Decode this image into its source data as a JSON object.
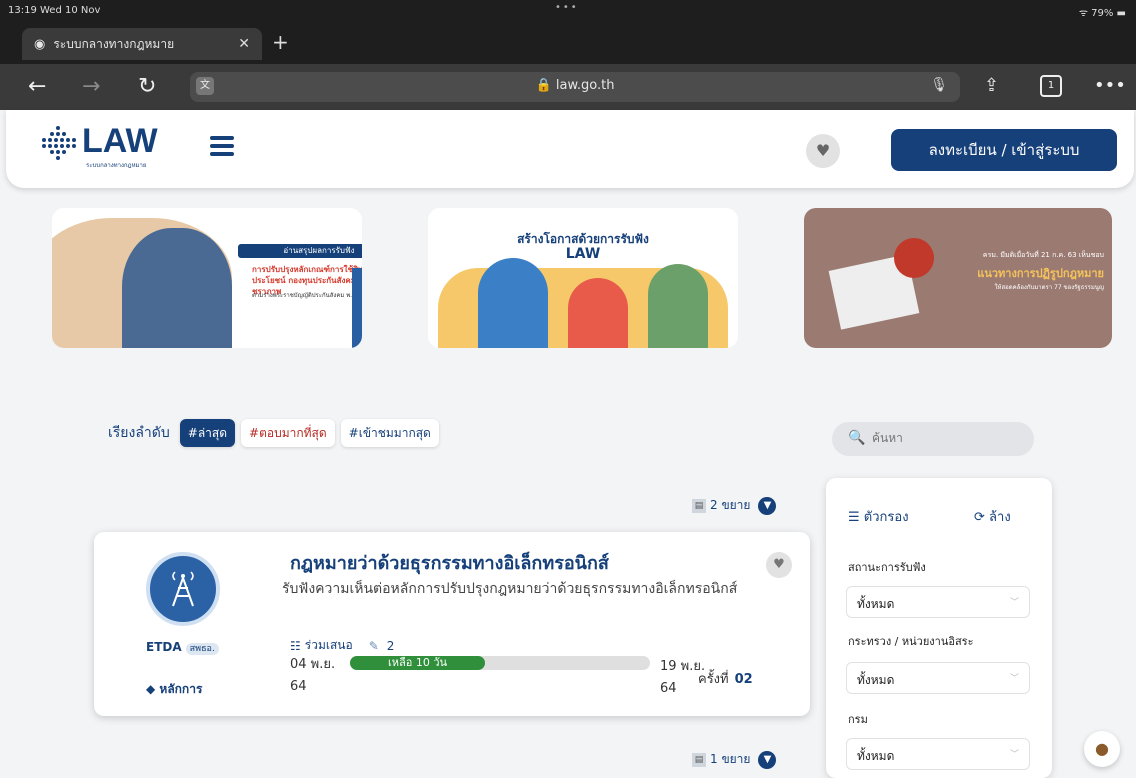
{
  "status_bar": {
    "time": "13:19  Wed 10 Nov",
    "dots": "•••",
    "battery": "79%"
  },
  "browser": {
    "tab_title": "ระบบกลางทางกฎหมาย",
    "tab_close": "✕",
    "new_tab": "+",
    "url": "law.go.th",
    "tab_count": "1"
  },
  "site": {
    "logo_text": "LAW",
    "logo_tagline": "ระบบกลางทางกฎหมาย",
    "register_label": "ลงทะเบียน / เข้าสู่ระบบ"
  },
  "banners": [
    {
      "label": "อ่านสรุปผลการรับฟัง",
      "headline": "การปรับปรุงหลักเกณฑ์การใช้สิทธิประโยชน์ กองทุนประกันสังคมกรณีชราภาพ",
      "subtext": "ตามร่างพระราชบัญญัติประกันสังคม พ.ศ. ...."
    },
    {
      "headline": "สร้างโอกาสด้วยการรับฟัง",
      "brand": "LAW"
    },
    {
      "line1": "ครม. มีมติเมื่อวันที่ 21 ก.ค. 63 เห็นชอบ",
      "headline": "แนวทางการปฏิรูปกฎหมาย",
      "line3": "ให้สอดคล้องกับมาตรา 77 ของรัฐธรรมนูญ"
    }
  ],
  "sort": {
    "label": "เรียงลำดับ",
    "options": [
      "#ล่าสุด",
      "#ตอบมากที่สุด",
      "#เข้าชมมากสุด"
    ]
  },
  "search": {
    "placeholder": "ค้นหา"
  },
  "expand_top": {
    "label": "2 ขยาย"
  },
  "expand_bottom": {
    "label": "1 ขยาย"
  },
  "card": {
    "agency": "ETDA",
    "agency_sub": "สพธอ.",
    "category": "หลักการ",
    "title": "กฎหมายว่าด้วยธุรกรรมทางอิเล็กทรอนิกส์",
    "description": "รับฟังความเห็นต่อหลักการปรับปรุงกฎหมายว่าด้วยธุรกรรมทางอิเล็กทรอนิกส์",
    "participate_label": "ร่วมเสนอ",
    "comment_count": "2",
    "start_date": "04 พ.ย.",
    "start_year": "64",
    "remaining": "เหลือ 10 วัน",
    "remaining_fraction": 0.45,
    "end_date": "19 พ.ย.",
    "end_year": "64",
    "round_label": "ครั้งที่",
    "round_value": "02"
  },
  "filter": {
    "title": "ตัวกรอง",
    "clear_label": "ล้าง",
    "status_label": "สถานะการรับฟัง",
    "status_value": "ทั้งหมด",
    "ministry_label": "กระทรวง / หน่วยงานอิสระ",
    "ministry_value": "ทั้งหมด",
    "department_label": "กรม",
    "department_value": "ทั้งหมด"
  },
  "colors": {
    "primary": "#16407a",
    "progress": "#2f8f3a",
    "accent_red": "#b52a22"
  }
}
